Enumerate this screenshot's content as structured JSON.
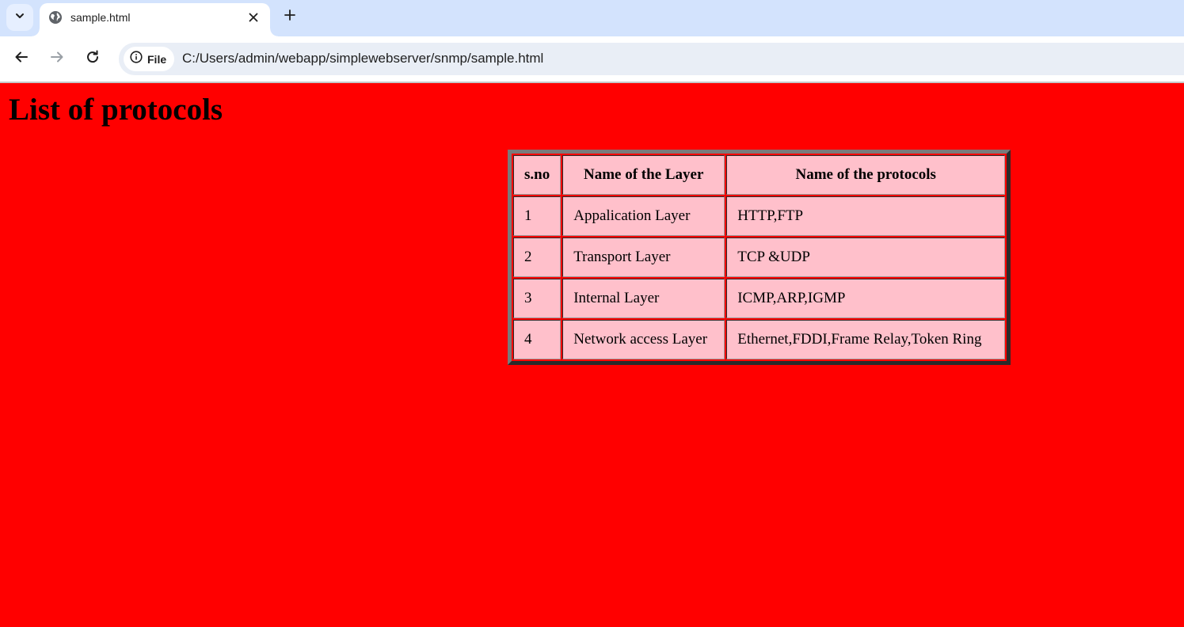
{
  "browser": {
    "tab": {
      "title": "sample.html"
    },
    "address_bar": {
      "chip_label": "File",
      "url": "C:/Users/admin/webapp/simplewebserver/snmp/sample.html"
    },
    "icons": [
      "tab-search-icon",
      "globe-icon",
      "close-icon",
      "plus-icon",
      "back-arrow-icon",
      "forward-arrow-icon",
      "reload-icon",
      "info-icon"
    ]
  },
  "page": {
    "background_color": "#ff0000",
    "title": "List of protocols",
    "table": {
      "cell_color": "#ffc0cb",
      "headers": [
        "s.no",
        "Name of the Layer",
        "Name of the protocols"
      ],
      "rows": [
        [
          "1",
          "Appalication Layer",
          "HTTP,FTP"
        ],
        [
          "2",
          "Transport Layer",
          "TCP &UDP"
        ],
        [
          "3",
          "Internal Layer",
          "ICMP,ARP,IGMP"
        ],
        [
          "4",
          "Network access Layer",
          "Ethernet,FDDI,Frame Relay,Token Ring"
        ]
      ]
    }
  }
}
